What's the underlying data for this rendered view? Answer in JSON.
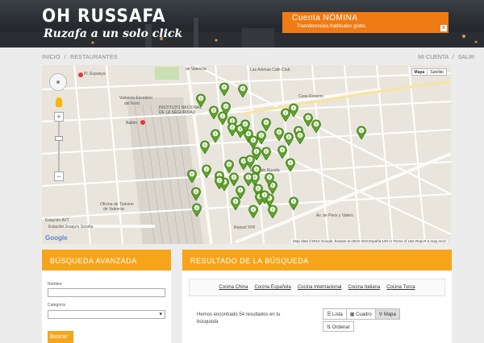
{
  "header": {
    "logo_title": "OH RUSSAFA",
    "logo_subtitle": "Ruzafa a un solo click",
    "ad_title": "Cuenta NÓMINA",
    "ad_subtitle": "Transferencias habituales gratis.",
    "ad_close": "x"
  },
  "breadcrumb": {
    "home": "INICIO",
    "sep": "/",
    "current": "RESTAURANTES"
  },
  "account": {
    "my_account": "MI CUENTA",
    "sep": "/",
    "logout": "SALIR"
  },
  "map": {
    "type_map": "Mapa",
    "type_satellite": "Satélite",
    "zoom_in": "+",
    "zoom_out": "−",
    "google": "Google",
    "footer_data": "Map data ©2014 Google, basado en BCN IGN España",
    "footer_scale": "100 m",
    "footer_terms": "Terms of Use",
    "footer_report": "Report a map error",
    "labels": {
      "pl_espanya": "Pl. Espanya",
      "valencia_escaleno": "Valencia-Escaleno",
      "del_nord": "del Nord",
      "instituto": "INSTITUTO NACIONAL",
      "seguridad": "DE LA SEGURIDAD",
      "bailen": "Bailén",
      "estacion_avt": "Estación AVT",
      "joaquin_sorolla": "Estación Joaquín Sorolla",
      "oficina_turismo": "Oficina de Turismo",
      "de_valencia": "de Valencia",
      "casa_roberto": "Casa Roberto",
      "mercado_ruzafa": "Mercado Ruzafa",
      "repsol": "Repsol YPF",
      "av_peris": "Av. de Peris y Valero",
      "animas": "Las Animas Café Club",
      "valencia_top": "de Valencia"
    }
  },
  "search": {
    "title": "BÚSQUEDA AVANZADA",
    "name_label": "Nombre",
    "name_value": "",
    "category_label": "Categoría",
    "category_value": "",
    "submit": "Buscar"
  },
  "results": {
    "title": "RESULTADO DE LA BÚSQUEDA",
    "cuisines": [
      "Cocina China",
      "Cocina Española",
      "Cocina Internacional",
      "Cocina Italiana",
      "Cocina Turca"
    ],
    "summary_pre": "Hemos encontrado ",
    "summary_count": "54",
    "summary_post": " resultados en tu búsqueda",
    "view_list": "Lista",
    "view_grid": "Cuadro",
    "view_map": "Mapa",
    "order": "Ordenar"
  },
  "colors": {
    "accent": "#f6a51b",
    "ad": "#f07b14",
    "marker": "#5fa32b"
  }
}
